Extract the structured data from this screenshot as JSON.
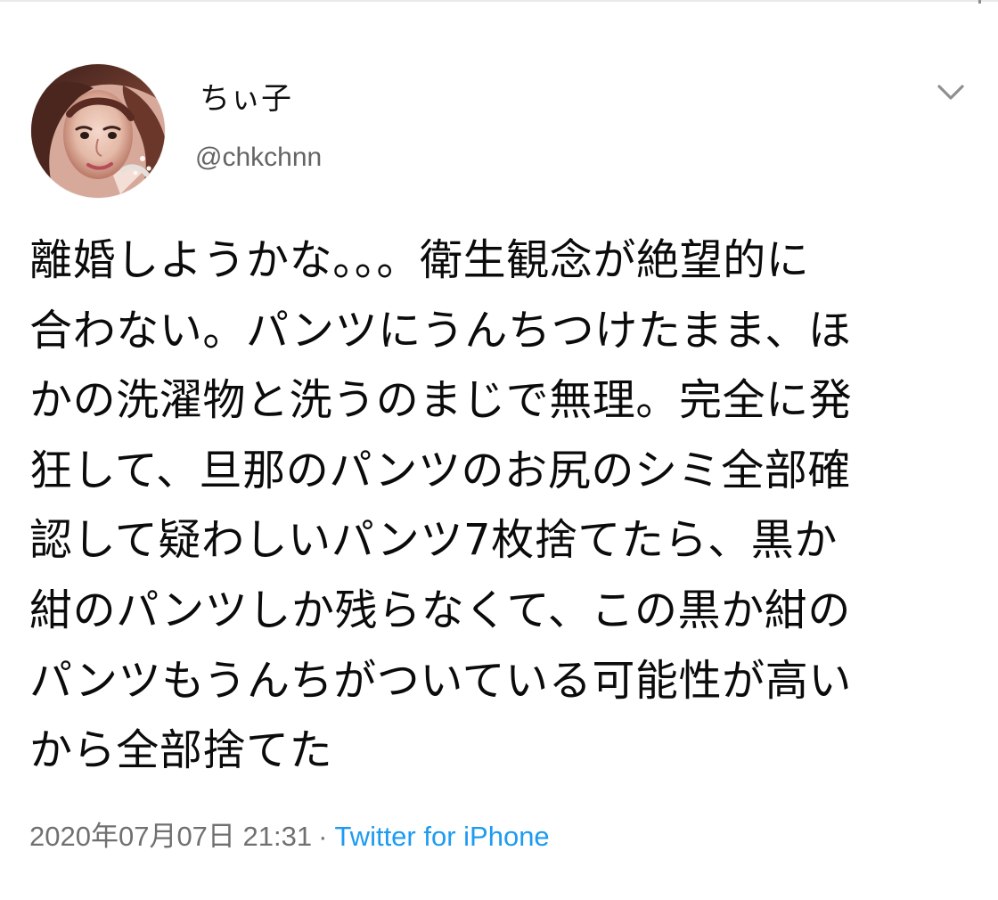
{
  "tweet": {
    "display_name": "ちぃ子",
    "handle": "@chkchnn",
    "text": "離婚しようかな。。。衛生観念が絶望的に\n合わない。パンツにうんちつけたまま、ほ\nかの洗濯物と洗うのまじで無理。完全に発\n狂して、旦那のパンツのお尻のシミ全部確\n認して疑わしいパンツ7枚捨てたら、黒か\n紺のパンツしか残らなくて、この黒か紺の\nパンツもうんちがついている可能性が高い\nから全部捨てた",
    "timestamp": "2020年07月07日 21:31",
    "separator": "·",
    "source": "Twitter for iPhone"
  },
  "icons": {
    "menu": "chevron-down-icon",
    "avatar": "profile-avatar"
  },
  "colors": {
    "background": "#ffffff",
    "text": "#0b0b0b",
    "secondary_text": "#707070",
    "link": "#1d9bf0"
  }
}
